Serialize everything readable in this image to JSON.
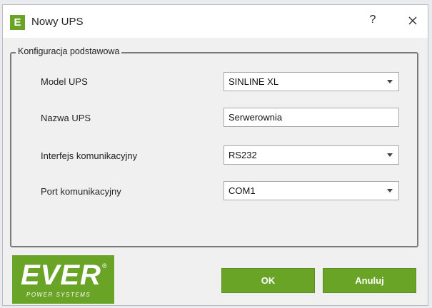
{
  "window": {
    "icon_letter": "E",
    "title": "Nowy UPS",
    "help_label": "?",
    "close_icon": "close-x-icon"
  },
  "group": {
    "legend": "Konfiguracja podstawowa",
    "fields": [
      {
        "label": "Model UPS",
        "type": "select",
        "value": "SINLINE XL"
      },
      {
        "label": "Nazwa UPS",
        "type": "text",
        "value": "Serwerownia"
      },
      {
        "label": "Interfejs komunikacyjny",
        "type": "select",
        "value": "RS232"
      },
      {
        "label": "Port komunikacyjny",
        "type": "select",
        "value": "COM1"
      }
    ]
  },
  "logo": {
    "text": "EVER",
    "registered": "®",
    "tagline": "POWER SYSTEMS"
  },
  "buttons": {
    "ok": "OK",
    "cancel": "Anuluj"
  },
  "colors": {
    "accent": "#6aa427",
    "window_bg": "#f0f0f0"
  }
}
